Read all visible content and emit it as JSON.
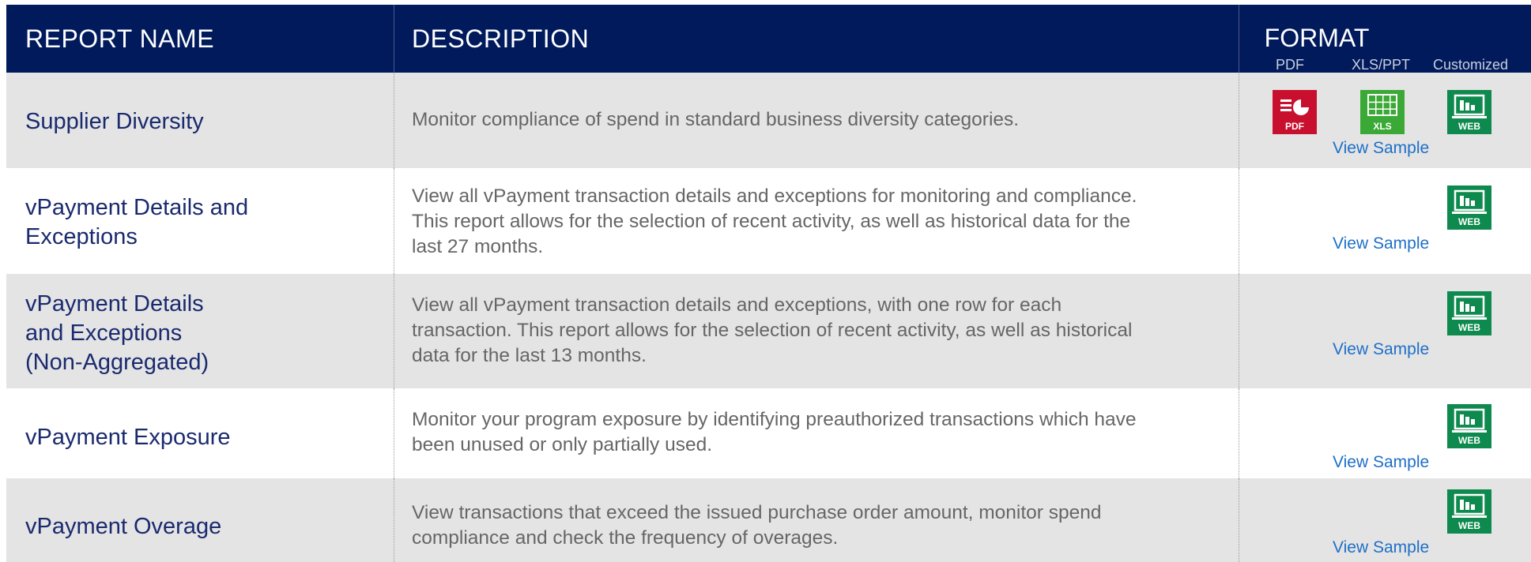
{
  "header": {
    "report_name": "REPORT NAME",
    "description": "DESCRIPTION",
    "format": "FORMAT",
    "format_pdf": "PDF",
    "format_xls": "XLS/PPT",
    "format_custom": "Customized"
  },
  "rows": [
    {
      "name_lines": [
        "Supplier Diversity"
      ],
      "description_lines": [
        "Monitor compliance of spend in standard business diversity categories."
      ],
      "formats": [
        "pdf-icon",
        "xls-icon",
        "web-icon"
      ],
      "sample_link": "View Sample"
    },
    {
      "name_lines": [
        "vPayment Details and",
        "Exceptions"
      ],
      "description_lines": [
        "View all vPayment transaction details and exceptions for monitoring and compliance.",
        "This report allows for the selection of recent activity, as well as historical data for the",
        "last 27 months."
      ],
      "formats": [
        "web-icon"
      ],
      "sample_link": "View Sample"
    },
    {
      "name_lines": [
        "vPayment Details",
        "and Exceptions",
        "(Non-Aggregated)"
      ],
      "description_lines": [
        "View all vPayment transaction details and exceptions, with one row for each",
        "transaction. This report allows for the selection of recent activity, as well as historical",
        "data for the last 13 months."
      ],
      "formats": [
        "web-icon"
      ],
      "sample_link": "View Sample"
    },
    {
      "name_lines": [
        "vPayment Exposure"
      ],
      "description_lines": [
        "Monitor your program exposure by identifying preauthorized transactions which have",
        "been unused or only partially used."
      ],
      "formats": [
        "web-icon"
      ],
      "sample_link": "View Sample"
    },
    {
      "name_lines": [
        "vPayment Overage"
      ],
      "description_lines": [
        "View transactions that exceed the issued purchase order amount, monitor spend",
        "compliance and check the frequency of overages."
      ],
      "formats": [
        "web-icon"
      ],
      "sample_link": "View Sample"
    }
  ],
  "icon_labels": {
    "pdf": "PDF",
    "xls": "XLS",
    "web": "WEB"
  },
  "colors": {
    "header_bg": "#001a5c",
    "row_shade": "#e4e4e4",
    "pdf": "#c8102e",
    "xls": "#3aa935",
    "web": "#0e8a4e",
    "link": "#1e6fc8"
  }
}
